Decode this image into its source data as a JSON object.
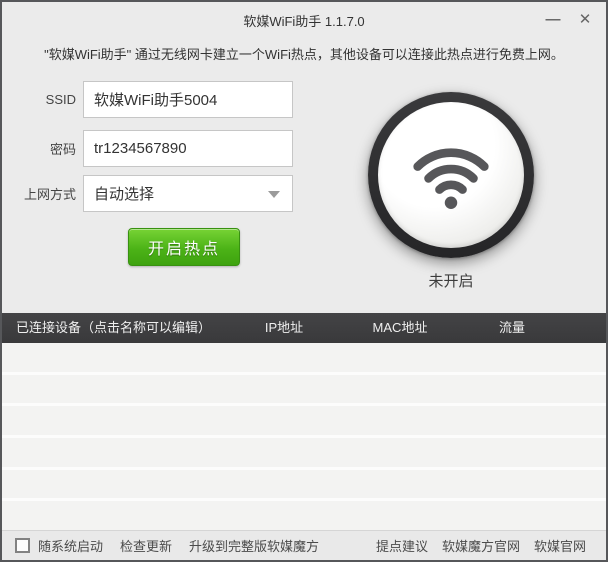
{
  "window": {
    "title": "软媒WiFi助手 1.1.7.0",
    "controls": {
      "minimize": "—",
      "close": "✕"
    }
  },
  "description": "\"软媒WiFi助手\" 通过无线网卡建立一个WiFi热点，其他设备可以连接此热点进行免费上网。",
  "form": {
    "ssid": {
      "label": "SSID",
      "value": "软媒WiFi助手5004"
    },
    "password": {
      "label": "密码",
      "value": "tr1234567890"
    },
    "mode": {
      "label": "上网方式",
      "value": "自动选择"
    },
    "start_button": "开启热点"
  },
  "status": {
    "label": "未开启"
  },
  "table": {
    "headers": [
      "已连接设备（点击名称可以编辑）",
      "IP地址",
      "MAC地址",
      "流量"
    ],
    "rows": []
  },
  "footer": {
    "autostart": "随系统启动",
    "check_update": "检查更新",
    "upgrade": "升级到完整版软媒魔方",
    "links": [
      "提点建议",
      "软媒魔方官网",
      "软媒官网"
    ]
  },
  "colors": {
    "accent_green": "#4cb317",
    "header_dark": "#3e3e40",
    "window_bg": "#ebebeb",
    "ring_dark": "#2d2d2f"
  }
}
